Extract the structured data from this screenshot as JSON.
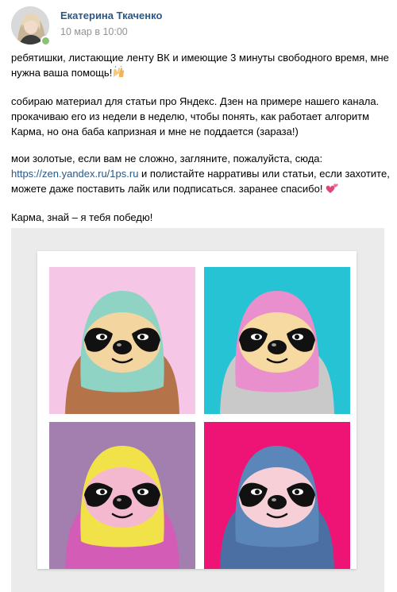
{
  "post": {
    "author": "Екатерина Ткаченко",
    "date": "10 мар в 10:00",
    "paragraphs": [
      "ребятишки, листающие ленту ВК и имеющие 3 минуты свободного время, мне нужна ваша помощь!",
      "собираю материал для статьи про Яндекс. Дзен на примере нашего канала. прокачиваю его из недели в неделю, чтобы понять, как работает алгоритм Карма, но она баба капризная и мне не поддается (зараза!)"
    ],
    "p3": {
      "before": "мои золотые, если вам не сложно, загляните, пожалуйста, сюда: ",
      "link1": "https://zen.yandex.ru/",
      "link2": "1ps.ru",
      "after": " и полистайте нарративы или статьи, если захотите, можете даже поставить лайк или подписаться. заранее спасибо! "
    },
    "closing": "Карма, знай – я тебя победю!",
    "link_color": "#2a5885",
    "online_color": "#8ac176"
  },
  "image": {
    "tiles": [
      {
        "bg": "#f6c6e6",
        "fur": "#8fd3c4",
        "body": "#b5734a",
        "face": "#f3d5a0"
      },
      {
        "bg": "#25c3d3",
        "fur": "#e98fcd",
        "body": "#c9c9c9",
        "face": "#f7d9a2"
      },
      {
        "bg": "#a27fae",
        "fur": "#f2e24a",
        "body": "#d25cb6",
        "face": "#f5b9cf"
      },
      {
        "bg": "#ee1475",
        "fur": "#5b86b9",
        "body": "#4b6ea3",
        "face": "#f6d0d6"
      }
    ]
  }
}
